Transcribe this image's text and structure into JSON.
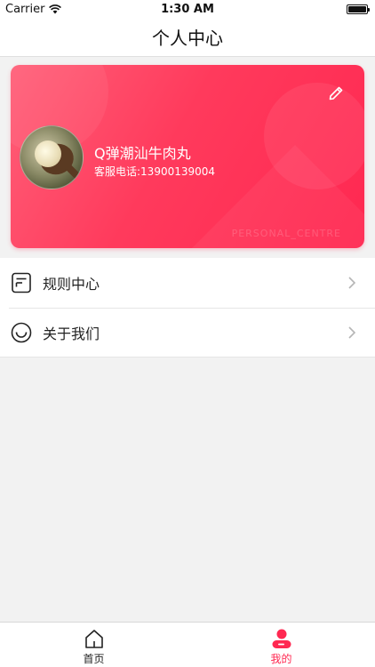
{
  "status_bar": {
    "carrier": "Carrier",
    "time": "1:30 AM",
    "icons": [
      "wifi-icon",
      "battery-icon"
    ]
  },
  "nav": {
    "title": "个人中心"
  },
  "profile": {
    "name": "Q弹潮汕牛肉丸",
    "phone_label": "客服电话:13900139004",
    "watermark": "PERSONAL_CENTRE",
    "edit_icon": "pencil-icon",
    "gradient": [
      "#ff5f78",
      "#ff2851"
    ]
  },
  "menu": {
    "items": [
      {
        "label": "规则中心",
        "icon": "document-icon"
      },
      {
        "label": "关于我们",
        "icon": "smile-icon"
      }
    ]
  },
  "tab_bar": {
    "tabs": [
      {
        "label": "首页",
        "icon": "home-icon",
        "active": false
      },
      {
        "label": "我的",
        "icon": "profile-icon",
        "active": true
      }
    ],
    "active_color": "#ff2851",
    "inactive_color": "#222222"
  }
}
